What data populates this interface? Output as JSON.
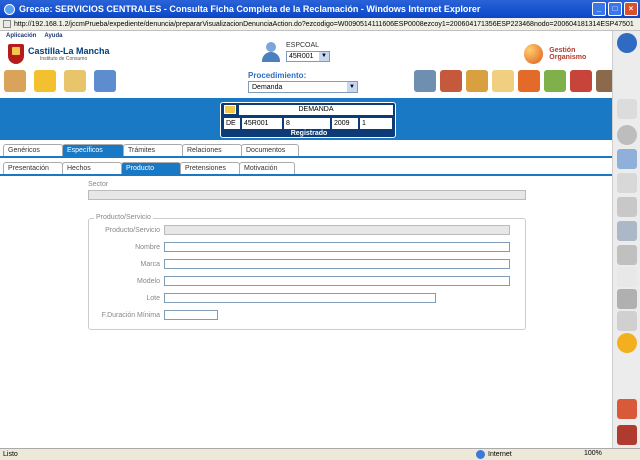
{
  "window": {
    "title": "Grecae: SERVICIOS CENTRALES - Consulta Ficha Completa de la Reclamación - Windows Internet Explorer",
    "address": "http://192.168.1.2/jccmPrueba/expediente/denuncia/prepararVisualizacionDenunciaAction.do?ezcodigo=W0090514111606ESP0008ezcoy1=200604171356ESP223468nodo=200604181314ESP47501"
  },
  "menu": {
    "items": [
      "Aplicación",
      "Ayuda"
    ]
  },
  "header": {
    "logo_text": "Castilla-La Mancha",
    "logo_subtext": "Instituto de Consumo",
    "user_name": "ESPCOAL",
    "user_select": "45R001",
    "gestion": "Gestión Organismo",
    "procedimiento_label": "Procedimiento:",
    "procedimiento_value": "Demanda"
  },
  "demanda": {
    "title": "DEMANDA",
    "cells": [
      "DE",
      "45R001",
      "8",
      "2009",
      "1"
    ],
    "status": "Registrado"
  },
  "tabs_row1": [
    "Genéricos",
    "Específicos",
    "Trámites",
    "Relaciones",
    "Documentos"
  ],
  "tabs_row2": [
    "Presentación",
    "Hechos",
    "Producto",
    "Pretensiones",
    "Motivación"
  ],
  "form": {
    "sector_label": "Sector",
    "legend": "Producto/Servicio",
    "fields": [
      "Producto/Servicio",
      "Nombre",
      "Marca",
      "Modelo",
      "Lote",
      "F.Duración Mínima"
    ]
  },
  "status": {
    "left": "Listo",
    "zone": "Internet",
    "zoom": "100%"
  },
  "colors": {
    "accent": "#1a79c4",
    "title_bar": "#0a46c8"
  }
}
